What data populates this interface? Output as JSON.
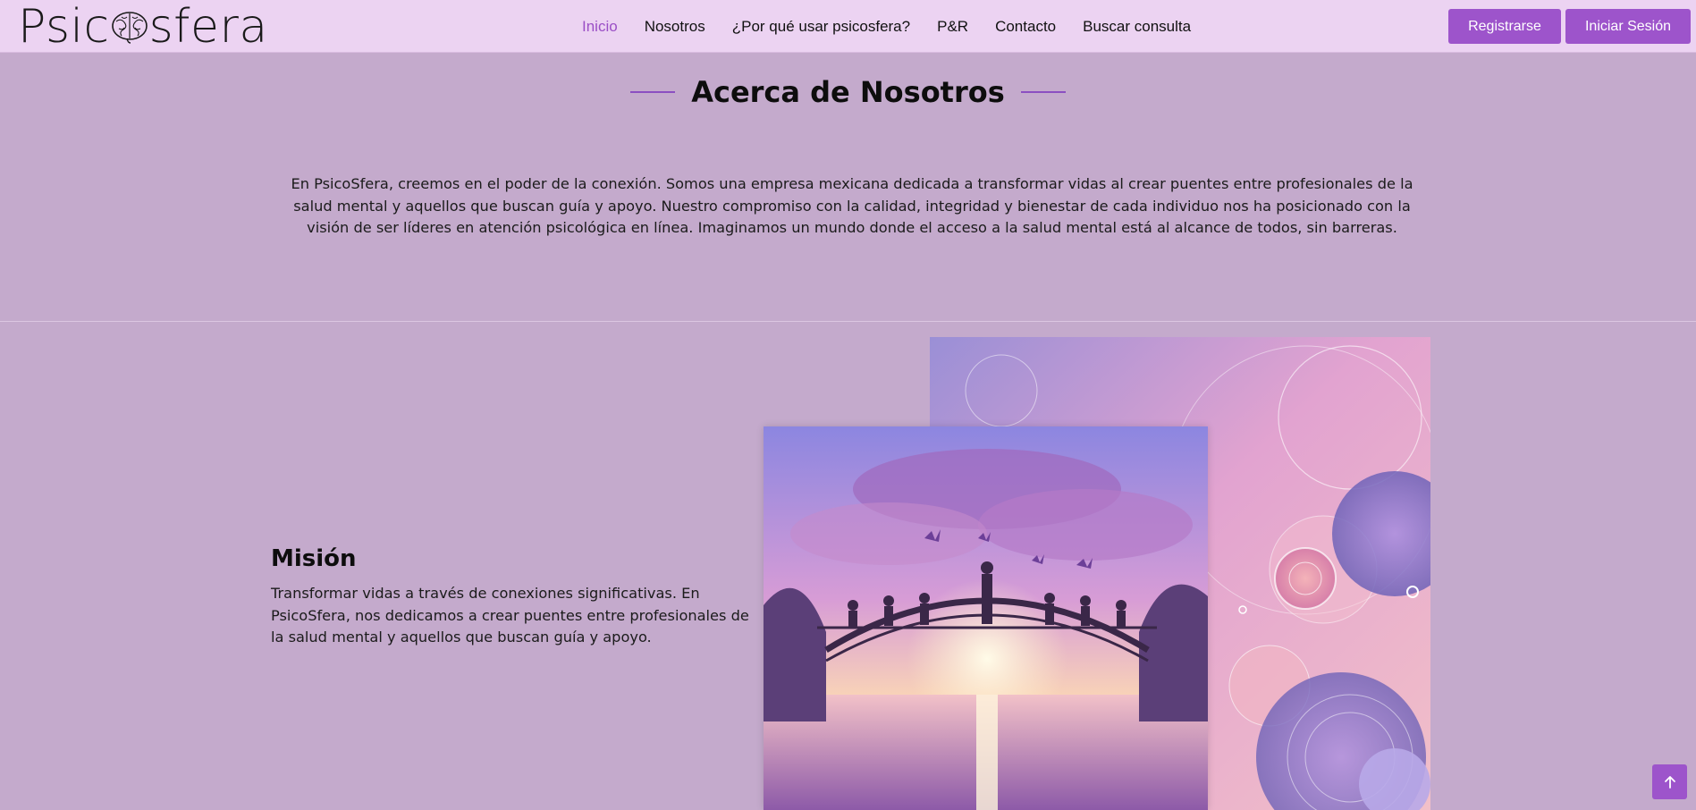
{
  "logo": {
    "text_before": "Psic",
    "text_after": "sfera",
    "icon": "brain-icon"
  },
  "nav": {
    "items": [
      {
        "label": "Inicio",
        "active": true
      },
      {
        "label": "Nosotros",
        "active": false
      },
      {
        "label": "¿Por qué usar psicosfera?",
        "active": false
      },
      {
        "label": "P&R",
        "active": false
      },
      {
        "label": "Contacto",
        "active": false
      },
      {
        "label": "Buscar consulta",
        "active": false
      }
    ],
    "register_label": "Registrarse",
    "login_label": "Iniciar Sesión"
  },
  "about": {
    "title": "Acerca de Nosotros",
    "text": "En PsicoSfera, creemos en el poder de la conexión. Somos una empresa mexicana dedicada a transformar vidas al crear puentes entre profesionales de la salud mental y aquellos que buscan guía y apoyo. Nuestro compromiso con la calidad, integridad y bienestar de cada individuo nos ha posicionado con la visión de ser líderes en atención psicológica en línea. Imaginamos un mundo donde el acceso a la salud mental está al alcance de todos, sin barreras."
  },
  "mission": {
    "title": "Misión",
    "text": "Transformar vidas a través de conexiones significativas. En PsicoSfera, nos dedicamos a crear puentes entre profesionales de la salud mental y aquellos que buscan guía y apoyo."
  },
  "colors": {
    "page_bg": "#c4aacc",
    "navbar_bg": "#ecd3f2",
    "accent": "#9d54cb",
    "active_link": "#9b4fc6"
  },
  "icons": {
    "scroll_top": "arrow-up-icon"
  }
}
